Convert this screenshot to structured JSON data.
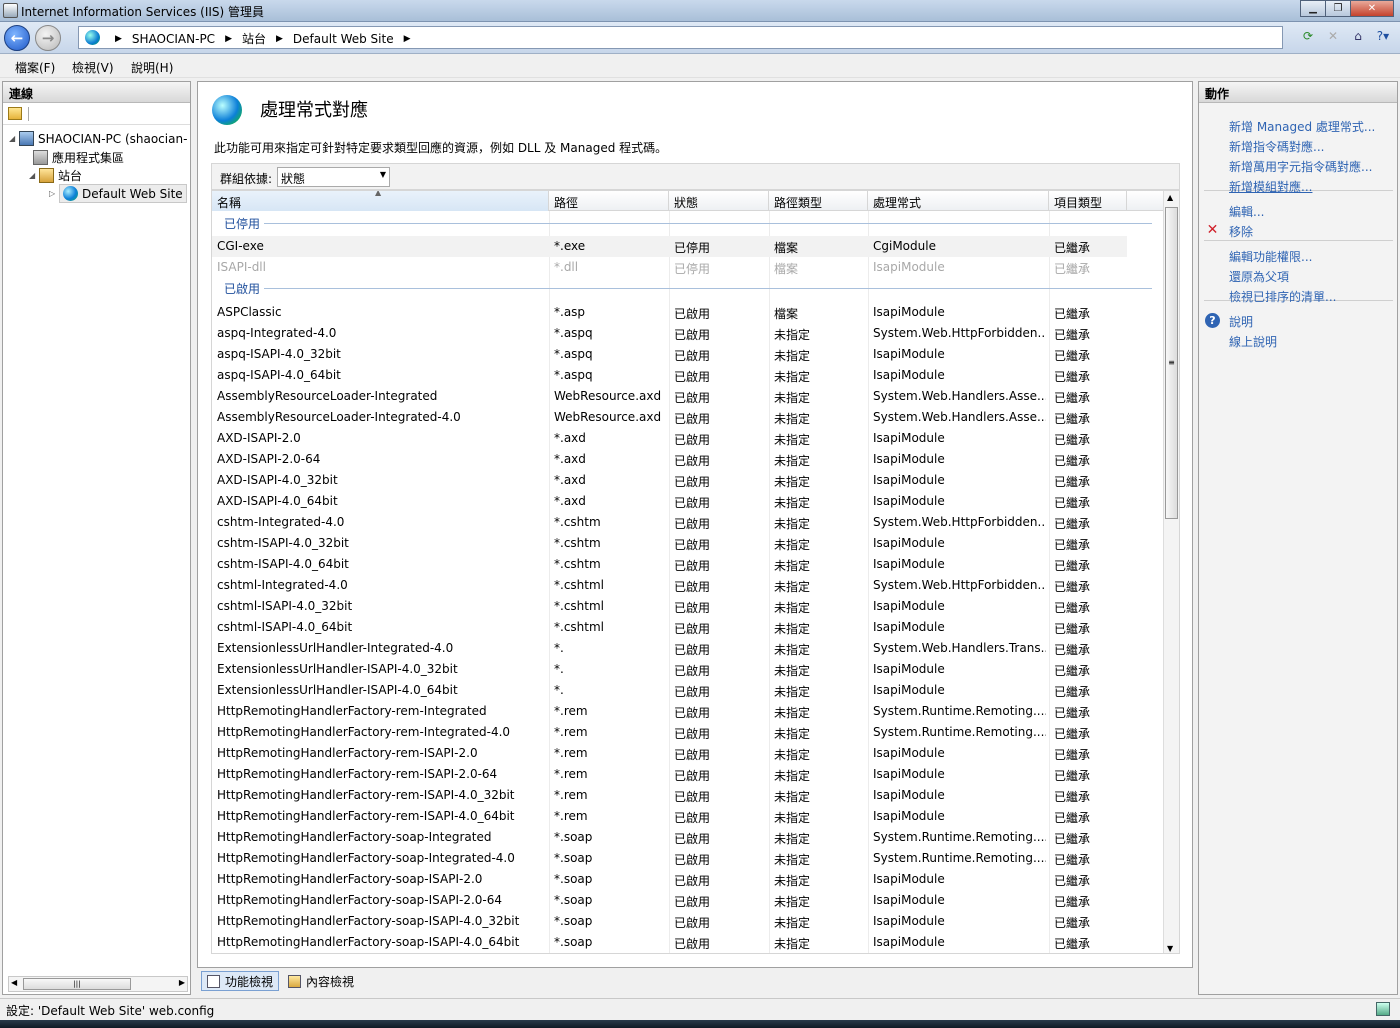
{
  "window": {
    "title": "Internet Information Services (IIS) 管理員"
  },
  "breadcrumb": [
    "SHAOCIAN-PC",
    "站台",
    "Default Web Site"
  ],
  "menu": [
    "檔案(F)",
    "檢視(V)",
    "說明(H)"
  ],
  "connections": {
    "header": "連線",
    "tree": [
      {
        "label": "SHAOCIAN-PC (shaocian-",
        "level": 0,
        "icon": "computer-icon"
      },
      {
        "label": "應用程式集區",
        "level": 1,
        "icon": "app-pool-icon"
      },
      {
        "label": "站台",
        "level": 1,
        "icon": "sites-folder-icon"
      },
      {
        "label": "Default Web Site",
        "level": 2,
        "icon": "globe-icon"
      }
    ]
  },
  "feature": {
    "title": "處理常式對應",
    "description": "此功能可用來指定可針對特定要求類型回應的資源，例如 DLL 及 Managed 程式碼。",
    "group_by_label": "群組依據:",
    "group_by_value": "狀態"
  },
  "table": {
    "columns": [
      "名稱",
      "路徑",
      "狀態",
      "路徑類型",
      "處理常式",
      "項目類型"
    ],
    "groups": [
      {
        "label": "已停用",
        "rows": [
          [
            "CGI-exe",
            "*.exe",
            "已停用",
            "檔案",
            "CgiModule",
            "已繼承"
          ],
          [
            "ISAPI-dll",
            "*.dll",
            "已停用",
            "檔案",
            "IsapiModule",
            "已繼承"
          ]
        ]
      },
      {
        "label": "已啟用",
        "rows": [
          [
            "ASPClassic",
            "*.asp",
            "已啟用",
            "檔案",
            "IsapiModule",
            "已繼承"
          ],
          [
            "aspq-Integrated-4.0",
            "*.aspq",
            "已啟用",
            "未指定",
            "System.Web.HttpForbidden...",
            "已繼承"
          ],
          [
            "aspq-ISAPI-4.0_32bit",
            "*.aspq",
            "已啟用",
            "未指定",
            "IsapiModule",
            "已繼承"
          ],
          [
            "aspq-ISAPI-4.0_64bit",
            "*.aspq",
            "已啟用",
            "未指定",
            "IsapiModule",
            "已繼承"
          ],
          [
            "AssemblyResourceLoader-Integrated",
            "WebResource.axd",
            "已啟用",
            "未指定",
            "System.Web.Handlers.Asse...",
            "已繼承"
          ],
          [
            "AssemblyResourceLoader-Integrated-4.0",
            "WebResource.axd",
            "已啟用",
            "未指定",
            "System.Web.Handlers.Asse...",
            "已繼承"
          ],
          [
            "AXD-ISAPI-2.0",
            "*.axd",
            "已啟用",
            "未指定",
            "IsapiModule",
            "已繼承"
          ],
          [
            "AXD-ISAPI-2.0-64",
            "*.axd",
            "已啟用",
            "未指定",
            "IsapiModule",
            "已繼承"
          ],
          [
            "AXD-ISAPI-4.0_32bit",
            "*.axd",
            "已啟用",
            "未指定",
            "IsapiModule",
            "已繼承"
          ],
          [
            "AXD-ISAPI-4.0_64bit",
            "*.axd",
            "已啟用",
            "未指定",
            "IsapiModule",
            "已繼承"
          ],
          [
            "cshtm-Integrated-4.0",
            "*.cshtm",
            "已啟用",
            "未指定",
            "System.Web.HttpForbidden...",
            "已繼承"
          ],
          [
            "cshtm-ISAPI-4.0_32bit",
            "*.cshtm",
            "已啟用",
            "未指定",
            "IsapiModule",
            "已繼承"
          ],
          [
            "cshtm-ISAPI-4.0_64bit",
            "*.cshtm",
            "已啟用",
            "未指定",
            "IsapiModule",
            "已繼承"
          ],
          [
            "cshtml-Integrated-4.0",
            "*.cshtml",
            "已啟用",
            "未指定",
            "System.Web.HttpForbidden...",
            "已繼承"
          ],
          [
            "cshtml-ISAPI-4.0_32bit",
            "*.cshtml",
            "已啟用",
            "未指定",
            "IsapiModule",
            "已繼承"
          ],
          [
            "cshtml-ISAPI-4.0_64bit",
            "*.cshtml",
            "已啟用",
            "未指定",
            "IsapiModule",
            "已繼承"
          ],
          [
            "ExtensionlessUrlHandler-Integrated-4.0",
            "*.",
            "已啟用",
            "未指定",
            "System.Web.Handlers.Trans...",
            "已繼承"
          ],
          [
            "ExtensionlessUrlHandler-ISAPI-4.0_32bit",
            "*.",
            "已啟用",
            "未指定",
            "IsapiModule",
            "已繼承"
          ],
          [
            "ExtensionlessUrlHandler-ISAPI-4.0_64bit",
            "*.",
            "已啟用",
            "未指定",
            "IsapiModule",
            "已繼承"
          ],
          [
            "HttpRemotingHandlerFactory-rem-Integrated",
            "*.rem",
            "已啟用",
            "未指定",
            "System.Runtime.Remoting....",
            "已繼承"
          ],
          [
            "HttpRemotingHandlerFactory-rem-Integrated-4.0",
            "*.rem",
            "已啟用",
            "未指定",
            "System.Runtime.Remoting....",
            "已繼承"
          ],
          [
            "HttpRemotingHandlerFactory-rem-ISAPI-2.0",
            "*.rem",
            "已啟用",
            "未指定",
            "IsapiModule",
            "已繼承"
          ],
          [
            "HttpRemotingHandlerFactory-rem-ISAPI-2.0-64",
            "*.rem",
            "已啟用",
            "未指定",
            "IsapiModule",
            "已繼承"
          ],
          [
            "HttpRemotingHandlerFactory-rem-ISAPI-4.0_32bit",
            "*.rem",
            "已啟用",
            "未指定",
            "IsapiModule",
            "已繼承"
          ],
          [
            "HttpRemotingHandlerFactory-rem-ISAPI-4.0_64bit",
            "*.rem",
            "已啟用",
            "未指定",
            "IsapiModule",
            "已繼承"
          ],
          [
            "HttpRemotingHandlerFactory-soap-Integrated",
            "*.soap",
            "已啟用",
            "未指定",
            "System.Runtime.Remoting....",
            "已繼承"
          ],
          [
            "HttpRemotingHandlerFactory-soap-Integrated-4.0",
            "*.soap",
            "已啟用",
            "未指定",
            "System.Runtime.Remoting....",
            "已繼承"
          ],
          [
            "HttpRemotingHandlerFactory-soap-ISAPI-2.0",
            "*.soap",
            "已啟用",
            "未指定",
            "IsapiModule",
            "已繼承"
          ],
          [
            "HttpRemotingHandlerFactory-soap-ISAPI-2.0-64",
            "*.soap",
            "已啟用",
            "未指定",
            "IsapiModule",
            "已繼承"
          ],
          [
            "HttpRemotingHandlerFactory-soap-ISAPI-4.0_32bit",
            "*.soap",
            "已啟用",
            "未指定",
            "IsapiModule",
            "已繼承"
          ],
          [
            "HttpRemotingHandlerFactory-soap-ISAPI-4.0_64bit",
            "*.soap",
            "已啟用",
            "未指定",
            "IsapiModule",
            "已繼承"
          ]
        ]
      }
    ]
  },
  "view_tabs": [
    "功能檢視",
    "內容檢視"
  ],
  "actions": {
    "header": "動作",
    "items": [
      {
        "label": "新增 Managed 處理常式...",
        "icon": ""
      },
      {
        "label": "新增指令碼對應...",
        "icon": ""
      },
      {
        "label": "新增萬用字元指令碼對應...",
        "icon": ""
      },
      {
        "label": "新增模組對應...",
        "icon": ""
      },
      {
        "label": "編輯...",
        "icon": ""
      },
      {
        "label": "移除",
        "icon": "remove-icon"
      },
      {
        "label": "編輯功能權限...",
        "icon": ""
      },
      {
        "label": "還原為父項",
        "icon": ""
      },
      {
        "label": "檢視已排序的清單...",
        "icon": ""
      },
      {
        "label": "說明",
        "icon": "help-icon"
      },
      {
        "label": "線上說明",
        "icon": ""
      }
    ]
  },
  "status": {
    "text": "設定: 'Default Web Site' web.config"
  },
  "colors": {
    "link": "#2f64b3",
    "group_header": "#1f4f9c",
    "disabled_text": "#a8a8a8",
    "remove_red": "#d0202a"
  }
}
